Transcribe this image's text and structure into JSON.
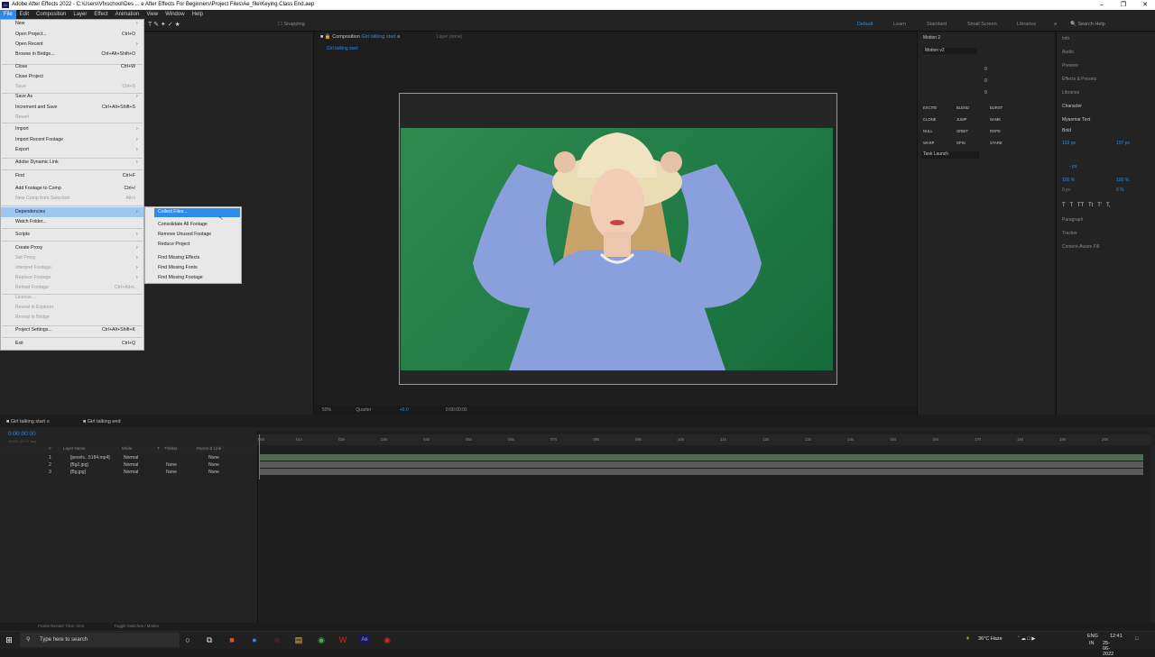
{
  "window": {
    "title": "Adobe After Effects 2022 - C:\\Users\\Vfxschool\\Des ... e After Effects  For Beginners\\Project Files\\Ae_file\\Keying Class End.aep",
    "logo": "Ae"
  },
  "menubar": [
    "File",
    "Edit",
    "Composition",
    "Layer",
    "Effect",
    "Animation",
    "View",
    "Window",
    "Help"
  ],
  "toolbar": {
    "snapping": "Snapping",
    "workspaces": [
      "Default",
      "Learn",
      "Standard",
      "Small Screen",
      "Libraries"
    ],
    "search_placeholder": "Search Help"
  },
  "file_menu": {
    "items": [
      {
        "label": "New",
        "shortcut": "",
        "submenu": true,
        "disabled": false
      },
      {
        "label": "Open Project...",
        "shortcut": "Ctrl+O",
        "submenu": false,
        "disabled": false
      },
      {
        "label": "Open Recent",
        "shortcut": "",
        "submenu": true,
        "disabled": false
      },
      {
        "label": "Browse in Bridge...",
        "shortcut": "Ctrl+Alt+Shift+O",
        "submenu": false,
        "disabled": false
      },
      {
        "label": "Close",
        "shortcut": "Ctrl+W",
        "submenu": false,
        "disabled": false
      },
      {
        "label": "Close Project",
        "shortcut": "",
        "submenu": false,
        "disabled": false
      },
      {
        "label": "Save",
        "shortcut": "Ctrl+S",
        "submenu": false,
        "disabled": true
      },
      {
        "label": "Save As",
        "shortcut": "",
        "submenu": true,
        "disabled": false
      },
      {
        "label": "Increment and Save",
        "shortcut": "Ctrl+Alt+Shift+S",
        "submenu": false,
        "disabled": false
      },
      {
        "label": "Revert",
        "shortcut": "",
        "submenu": false,
        "disabled": true
      },
      {
        "label": "Import",
        "shortcut": "",
        "submenu": true,
        "disabled": false
      },
      {
        "label": "Import Recent Footage",
        "shortcut": "",
        "submenu": true,
        "disabled": false
      },
      {
        "label": "Export",
        "shortcut": "",
        "submenu": true,
        "disabled": false
      },
      {
        "label": "Adobe Dynamic Link",
        "shortcut": "",
        "submenu": true,
        "disabled": false
      },
      {
        "label": "Find",
        "shortcut": "Ctrl+F",
        "submenu": false,
        "disabled": false
      },
      {
        "label": "Add Footage to Comp",
        "shortcut": "Ctrl+/",
        "submenu": false,
        "disabled": false
      },
      {
        "label": "New Comp from Selection",
        "shortcut": "Alt+\\",
        "submenu": false,
        "disabled": true
      },
      {
        "label": "Dependencies",
        "shortcut": "",
        "submenu": true,
        "disabled": false
      },
      {
        "label": "Watch Folder...",
        "shortcut": "",
        "submenu": false,
        "disabled": false
      },
      {
        "label": "Scripts",
        "shortcut": "",
        "submenu": true,
        "disabled": false
      },
      {
        "label": "Create Proxy",
        "shortcut": "",
        "submenu": true,
        "disabled": false
      },
      {
        "label": "Set Proxy",
        "shortcut": "",
        "submenu": true,
        "disabled": true
      },
      {
        "label": "Interpret Footage",
        "shortcut": "",
        "submenu": true,
        "disabled": true
      },
      {
        "label": "Replace Footage",
        "shortcut": "",
        "submenu": true,
        "disabled": true
      },
      {
        "label": "Reload Footage",
        "shortcut": "Ctrl+Alt+L",
        "submenu": false,
        "disabled": true
      },
      {
        "label": "License...",
        "shortcut": "",
        "submenu": false,
        "disabled": true
      },
      {
        "label": "Reveal in Explorer",
        "shortcut": "",
        "submenu": false,
        "disabled": true
      },
      {
        "label": "Reveal in Bridge",
        "shortcut": "",
        "submenu": false,
        "disabled": true
      },
      {
        "label": "Project Settings...",
        "shortcut": "Ctrl+Alt+Shift+K",
        "submenu": false,
        "disabled": false
      },
      {
        "label": "Exit",
        "shortcut": "Ctrl+Q",
        "submenu": false,
        "disabled": false
      }
    ]
  },
  "dependencies_submenu": [
    "Collect Files...",
    "Consolidate All Footage",
    "Remove Unused Footage",
    "Reduce Project",
    "Find Missing Effects",
    "Find Missing Fonts",
    "Find Missing Footage"
  ],
  "composition": {
    "tab_prefix": "Composition",
    "comp_name": "Girl talking start",
    "layer_tab": "Layer (none)",
    "zoom": "50%",
    "resolution": "Quarter",
    "exposure": "+0.0",
    "timecode": "0:00:00:00"
  },
  "motion_panel": {
    "title": "Motion 2",
    "version": "Motion v2",
    "values": [
      "0",
      "0",
      "0"
    ],
    "buttons": [
      "EXCITE",
      "BLEND",
      "BURST",
      "CLONE",
      "JUMP",
      "NAME",
      "NULL",
      "ORBIT",
      "ROPE",
      "WARP",
      "SPIN",
      "STARE"
    ],
    "task": "Task Launch"
  },
  "right_panel": {
    "items": [
      "Info",
      "Audio",
      "Preview",
      "Effects & Presets",
      "Libraries"
    ],
    "character": {
      "title": "Character",
      "font": "Myanmar Text",
      "style": "Bold",
      "size": "193 px",
      "leading": "197 px",
      "vert_scale": "100 %",
      "horiz_scale": "100 %",
      "baseline": "0 px",
      "tsume": "0 %",
      "stroke": "- px"
    },
    "more": [
      "Paragraph",
      "Tracker",
      "Content-Aware Fill"
    ]
  },
  "timeline": {
    "tabs": [
      "Girl talking start",
      "Girl talking end"
    ],
    "timecode": "0:00:00:00",
    "frames": "00000 (29.97 fps)",
    "columns": [
      "#",
      "Layer Name",
      "Mode",
      "T",
      "TrkMat",
      "Parent & Link"
    ],
    "layers": [
      {
        "num": "1",
        "name": "[pexels...5184.mp4]",
        "mode": "Normal",
        "trkmat": "",
        "parent": "None"
      },
      {
        "num": "2",
        "name": "[Bg2.jpg]",
        "mode": "Normal",
        "trkmat": "None",
        "parent": "None"
      },
      {
        "num": "3",
        "name": "[Bg.jpg]",
        "mode": "Normal",
        "trkmat": "None",
        "parent": "None"
      }
    ],
    "ruler": [
      "00s",
      "01s",
      "02s",
      "03s",
      "04s",
      "05s",
      "06s",
      "07s",
      "08s",
      "09s",
      "10s",
      "11s",
      "12s",
      "13s",
      "14s",
      "15s",
      "16s",
      "17s",
      "18s",
      "19s",
      "20s"
    ],
    "status_left": "Frame Render Time:",
    "render_time": "0ms",
    "status_mid": "Toggle Switches / Modes"
  },
  "taskbar": {
    "search_placeholder": "Type here to search",
    "weather": "36°C  Haze",
    "lang": "ENG",
    "region": "IN",
    "time": "12:41",
    "date": "25-06-2022"
  },
  "colors": {
    "accent": "#2d8ceb",
    "greenscreen": "#1f7a44",
    "menu_bg": "#e8e8e8"
  }
}
